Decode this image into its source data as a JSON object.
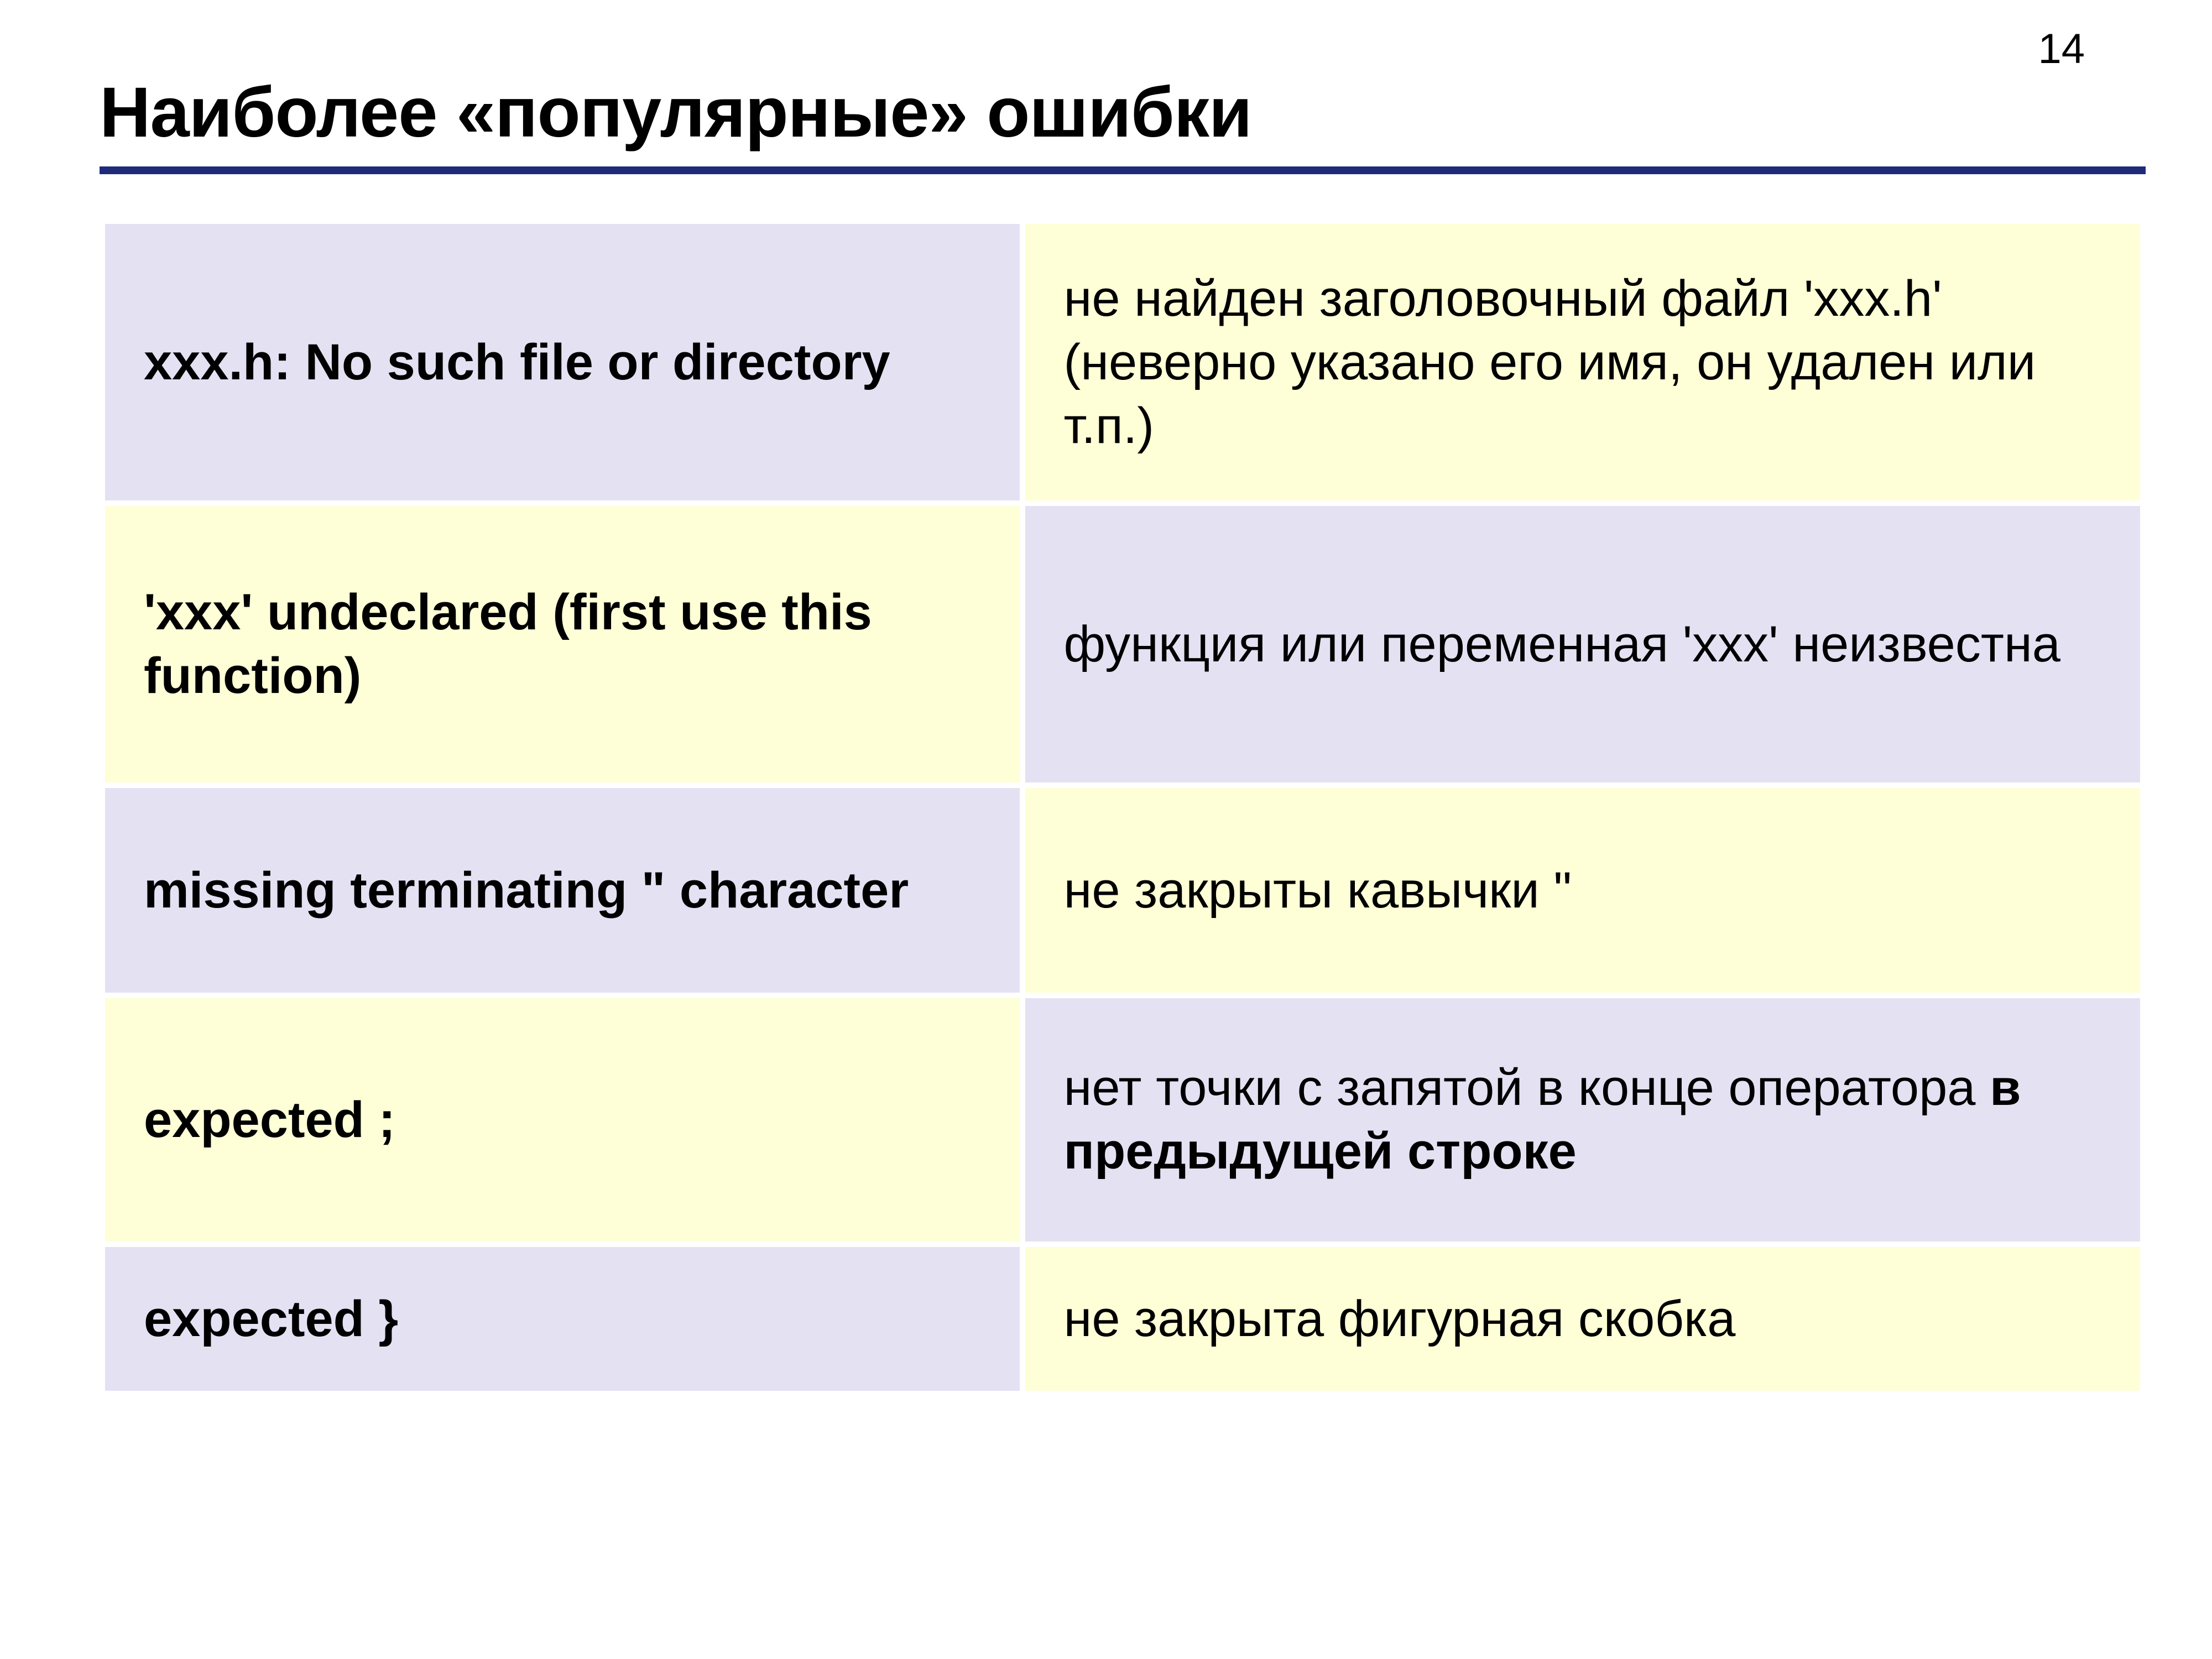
{
  "page_number": "14",
  "title": "Наиболее «популярные» ошибки",
  "rows": [
    {
      "error": "xxx.h: No such file or directory",
      "explanation": "не найден заголовочный файл 'xxx.h' (неверно указано его имя, он удален или т.п.)"
    },
    {
      "error": "'xxx' undeclared (first use this function)",
      "explanation": "функция или переменная 'xxx' неизвестна"
    },
    {
      "error": "missing terminating \" character",
      "explanation": "не закрыты кавычки \""
    },
    {
      "error": "expected  ;",
      "explanation_pre": "нет точки с запятой в конце оператора ",
      "explanation_bold": "в предыдущей строке"
    },
    {
      "error": "expected  }",
      "explanation": "не закрыта фигурная скобка"
    }
  ]
}
